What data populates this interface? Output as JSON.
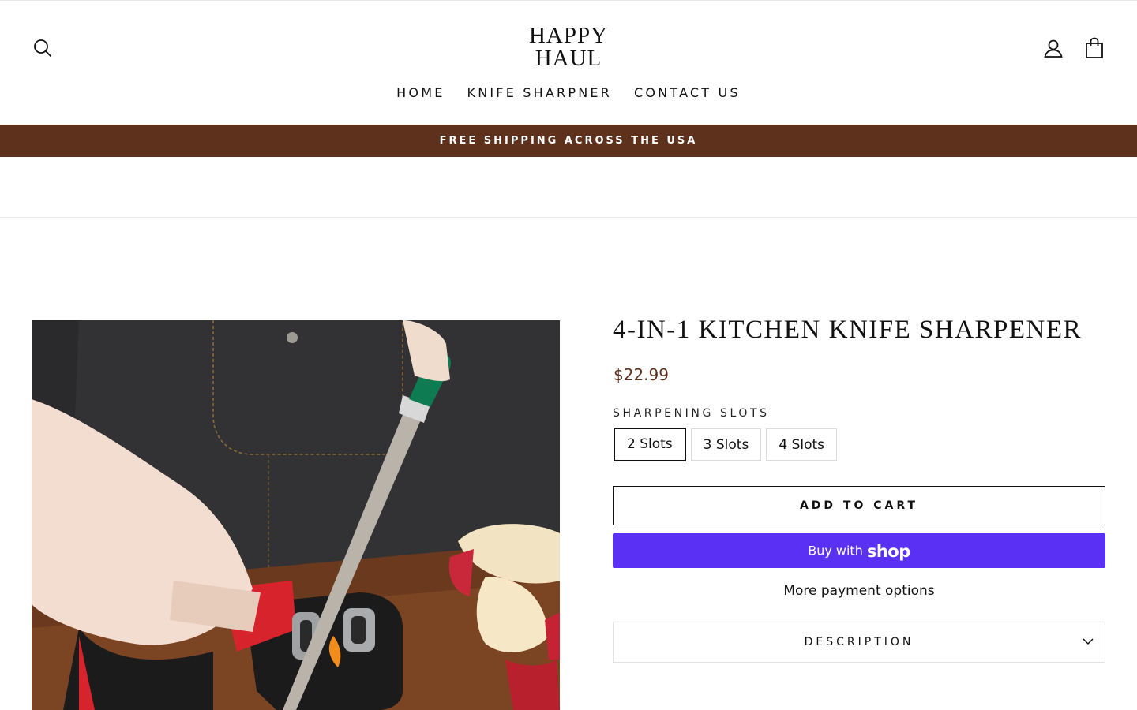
{
  "header": {
    "logo_line1": "HAPPY",
    "logo_line2": "HAUL",
    "icons": [
      "search-icon",
      "user-icon",
      "bag-icon"
    ],
    "nav": [
      {
        "label": "HOME"
      },
      {
        "label": "KNIFE SHARPNER"
      },
      {
        "label": "CONTACT US"
      }
    ]
  },
  "announcement": {
    "text": "FREE SHIPPING ACROSS THE USA",
    "background": "#5e311d"
  },
  "product": {
    "title": "4-IN-1 KITCHEN KNIFE SHARPENER",
    "price": "$22.99",
    "price_color": "#5e311d",
    "option_label": "SHARPENING SLOTS",
    "options": [
      "2 Slots",
      "3 Slots",
      "4 Slots"
    ],
    "selected_option": "2 Slots",
    "add_to_cart": "ADD TO CART",
    "buy_with": "Buy with",
    "shop_brand": "shop",
    "shop_pay_color": "#5a31f4",
    "more_payment": "More payment options",
    "description_label": "DESCRIPTION"
  }
}
